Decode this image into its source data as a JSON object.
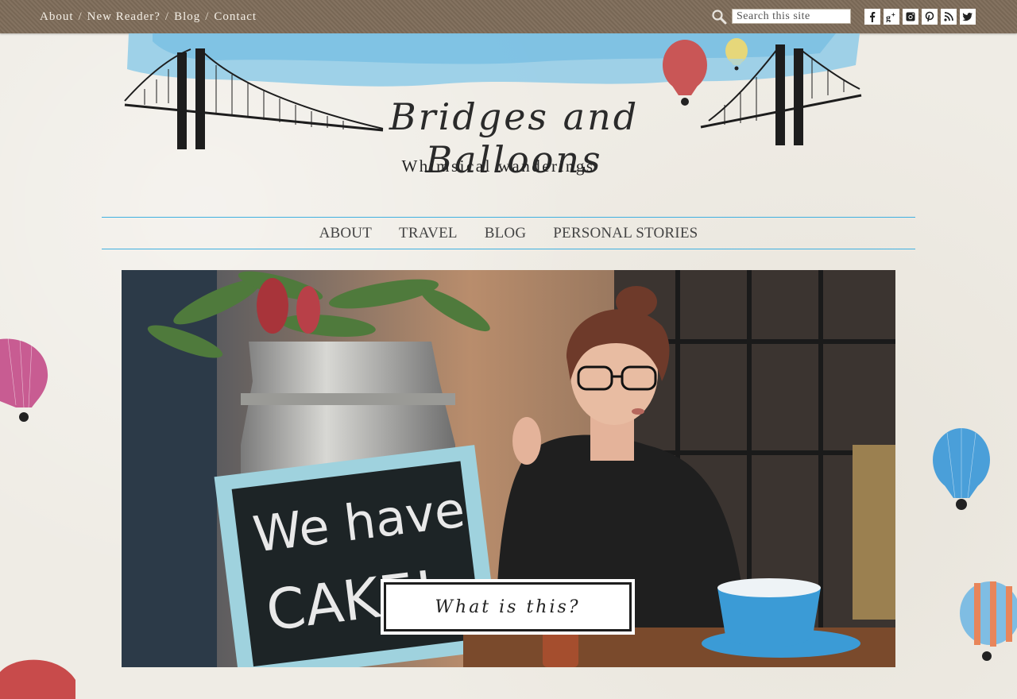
{
  "topnav": {
    "items": [
      "About",
      "New Reader?",
      "Blog",
      "Contact"
    ],
    "separator": "/"
  },
  "search": {
    "placeholder": "Search this site"
  },
  "social": [
    "facebook-icon",
    "google-plus-icon",
    "instagram-icon",
    "pinterest-icon",
    "rss-icon",
    "twitter-icon"
  ],
  "header": {
    "title": "Bridges and Balloons",
    "tagline": "Whimsical wanderings"
  },
  "mainnav": {
    "items": [
      "ABOUT",
      "TRAVEL",
      "BLOG",
      "PERSONAL STORIES"
    ]
  },
  "hero": {
    "sign_text_line1": "We have",
    "sign_text_line2": "CAKE!",
    "cta": "What is this?"
  },
  "colors": {
    "topbar": "#7d6b58",
    "accent": "#3fb0e0",
    "background": "#efece5"
  }
}
